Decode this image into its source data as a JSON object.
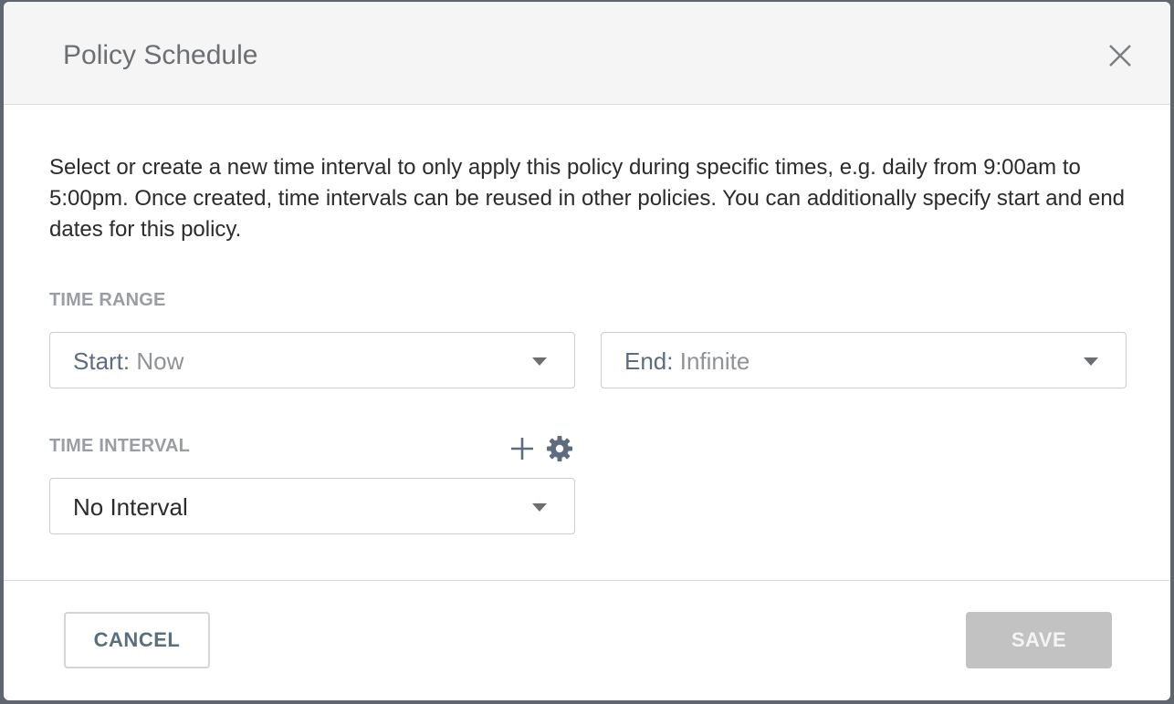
{
  "dialog": {
    "title": "Policy Schedule",
    "description": "Select or create a new time interval to only apply this policy during specific times, e.g. daily from 9:00am to 5:00pm. Once created, time intervals can be reused in other policies. You can additionally specify start and end dates for this policy."
  },
  "time_range": {
    "label": "TIME RANGE",
    "start": {
      "prefix": "Start:",
      "value": "Now"
    },
    "end": {
      "prefix": "End:",
      "value": "Infinite"
    }
  },
  "time_interval": {
    "label": "TIME INTERVAL",
    "selected": "No Interval"
  },
  "footer": {
    "cancel_label": "CANCEL",
    "save_label": "SAVE"
  },
  "icons": {
    "close": "close-icon",
    "add": "plus-icon",
    "settings": "gear-icon",
    "dropdown": "chevron-down-icon"
  },
  "colors": {
    "accent": "#5d6d80",
    "save_disabled": "#c2c2c2"
  }
}
